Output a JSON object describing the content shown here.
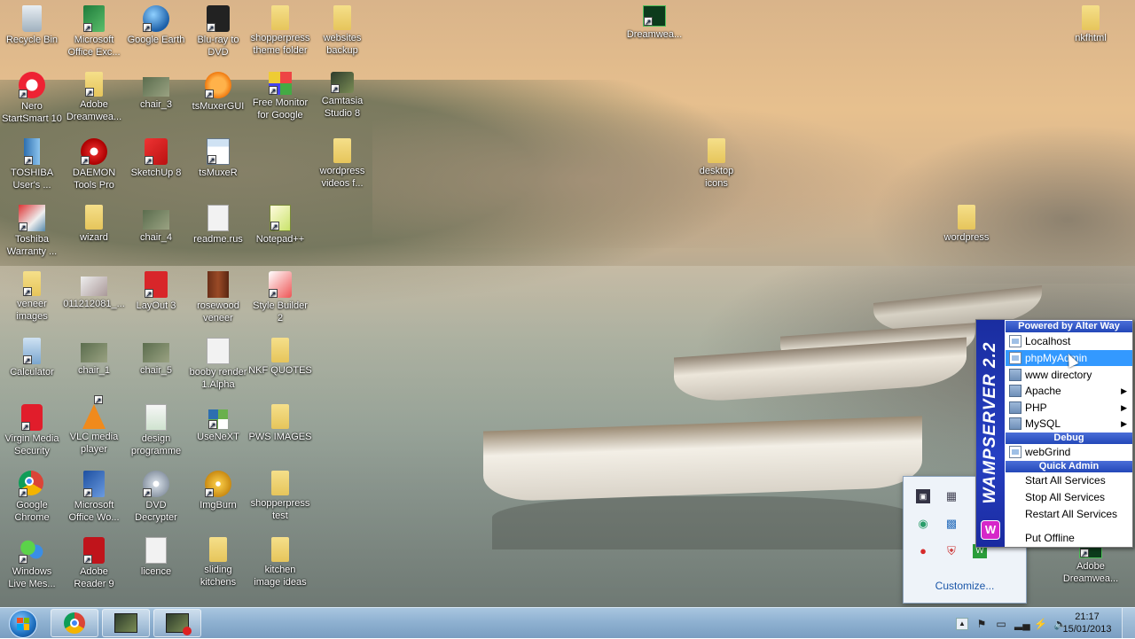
{
  "desktop": {
    "icons": [
      {
        "label": "Recycle Bin",
        "icon": "recycle-bin-icon"
      },
      {
        "label": "Microsoft\nOffice Exc...",
        "icon": "excel-icon"
      },
      {
        "label": "Google Earth",
        "icon": "google-earth-icon"
      },
      {
        "label": "Blu-ray to\nDVD",
        "icon": "dvd-icon"
      },
      {
        "label": "shopperpress\ntheme folder",
        "icon": "folder-icon"
      },
      {
        "label": "websites\nbackup",
        "icon": "folder-icon"
      },
      {
        "label": "Dreamwea...",
        "icon": "dreamweaver-icon"
      },
      {
        "label": "nkfhtml",
        "icon": "folder-icon"
      },
      {
        "label": "Nero\nStartSmart 10",
        "icon": "nero-icon"
      },
      {
        "label": "Adobe\nDreamwea...",
        "icon": "folder-icon"
      },
      {
        "label": "chair_3",
        "icon": "image-file-icon"
      },
      {
        "label": "tsMuxerGUI",
        "icon": "tsmuxer-icon"
      },
      {
        "label": "Free Monitor\nfor Google",
        "icon": "free-monitor-icon"
      },
      {
        "label": "Camtasia\nStudio 8",
        "icon": "camtasia-icon"
      },
      {
        "label": "TOSHIBA\nUser's ...",
        "icon": "toshiba-icon"
      },
      {
        "label": "DAEMON\nTools Pro",
        "icon": "daemon-tools-icon"
      },
      {
        "label": "SketchUp 8",
        "icon": "sketchup-icon"
      },
      {
        "label": "tsMuxeR",
        "icon": "tsmuxer-window-icon"
      },
      {
        "label": "wordpress\nvideos f...",
        "icon": "folder-icon"
      },
      {
        "label": "desktop\nicons",
        "icon": "folder-icon"
      },
      {
        "label": "Toshiba\nWarranty ...",
        "icon": "toshiba-warranty-icon"
      },
      {
        "label": "wizard",
        "icon": "folder-icon"
      },
      {
        "label": "chair_4",
        "icon": "image-file-icon"
      },
      {
        "label": "readme.rus",
        "icon": "text-file-icon"
      },
      {
        "label": "Notepad++",
        "icon": "notepad-plus-icon"
      },
      {
        "label": "wordpress",
        "icon": "folder-icon"
      },
      {
        "label": "veneer\nimages",
        "icon": "folder-icon"
      },
      {
        "label": "011212081_...",
        "icon": "image-file-icon"
      },
      {
        "label": "LayOut 3",
        "icon": "layout-icon"
      },
      {
        "label": "rosewood\nveneer",
        "icon": "image-file-icon"
      },
      {
        "label": "Style Builder\n2",
        "icon": "style-builder-icon"
      },
      {
        "label": "Calculator",
        "icon": "calculator-icon"
      },
      {
        "label": "chair_1",
        "icon": "image-file-icon"
      },
      {
        "label": "chair_5",
        "icon": "image-file-icon"
      },
      {
        "label": "booby render\n1.Alpha",
        "icon": "image-file-icon"
      },
      {
        "label": "NKF QUOTES",
        "icon": "folder-icon"
      },
      {
        "label": "Virgin Media\nSecurity",
        "icon": "virgin-security-icon"
      },
      {
        "label": "VLC media\nplayer",
        "icon": "vlc-icon"
      },
      {
        "label": "design\nprogramme",
        "icon": "spreadsheet-file-icon"
      },
      {
        "label": "UseNeXT",
        "icon": "usenext-icon"
      },
      {
        "label": "PWS IMAGES",
        "icon": "folder-icon"
      },
      {
        "label": "Google\nChrome",
        "icon": "chrome-icon"
      },
      {
        "label": "Microsoft\nOffice Wo...",
        "icon": "word-icon"
      },
      {
        "label": "DVD\nDecrypter",
        "icon": "dvd-decrypter-icon"
      },
      {
        "label": "ImgBurn",
        "icon": "imgburn-icon"
      },
      {
        "label": "shopperpress\ntest",
        "icon": "folder-icon"
      },
      {
        "label": "Windows\nLive Mes...",
        "icon": "messenger-icon"
      },
      {
        "label": "Adobe\nReader 9",
        "icon": "adobe-reader-icon"
      },
      {
        "label": "licence",
        "icon": "text-file-icon"
      },
      {
        "label": "sliding\nkitchens",
        "icon": "folder-icon"
      },
      {
        "label": "kitchen\nimage ideas",
        "icon": "folder-icon"
      },
      {
        "label": "Adobe\nDreamwea...",
        "icon": "dreamweaver-icon"
      }
    ]
  },
  "wamp_menu": {
    "brand": "WAMPSERVER 2.2",
    "powered_by": "Powered by Alter Way",
    "items": {
      "localhost": "Localhost",
      "phpmyadmin": "phpMyAdmin",
      "www_directory": "www directory",
      "apache": "Apache",
      "php": "PHP",
      "mysql": "MySQL"
    },
    "debug_header": "Debug",
    "webgrind": "webGrind",
    "quick_admin_header": "Quick Admin",
    "start_all": "Start All Services",
    "stop_all": "Stop All Services",
    "restart_all": "Restart All Services",
    "put_offline": "Put Offline",
    "highlighted": "phpMyAdmin"
  },
  "tray_overflow": {
    "customize": "Customize..."
  },
  "taskbar": {
    "clock_time": "21:17",
    "clock_date": "15/01/2013",
    "pinned": [
      "Google Chrome",
      "Camtasia Studio 8",
      "Camtasia Recorder"
    ]
  },
  "colors": {
    "wamp_blue": "#2640c2",
    "menu_highlight": "#3399ff",
    "taskbar": "#8fb1d1"
  }
}
